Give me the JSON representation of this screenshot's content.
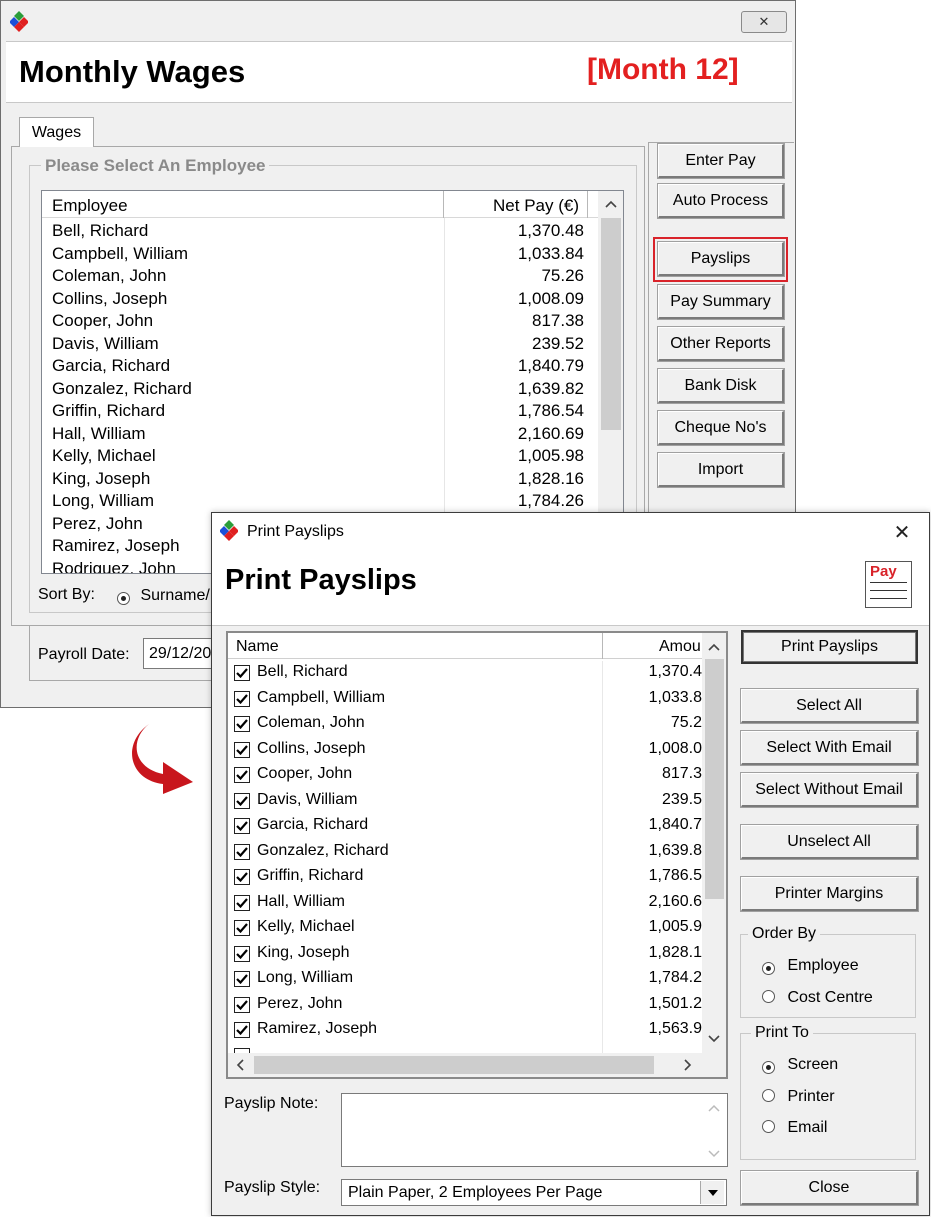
{
  "main": {
    "title": "Monthly Wages",
    "month_badge": "[Month 12]",
    "tab": "Wages",
    "group_label": "Please Select An Employee",
    "columns": {
      "employee": "Employee",
      "net_pay": "Net Pay (€)"
    },
    "employees": [
      {
        "name": "Bell, Richard",
        "pay": "1,370.48"
      },
      {
        "name": "Campbell, William",
        "pay": "1,033.84"
      },
      {
        "name": "Coleman, John",
        "pay": "75.26"
      },
      {
        "name": "Collins, Joseph",
        "pay": "1,008.09"
      },
      {
        "name": "Cooper, John",
        "pay": "817.38"
      },
      {
        "name": "Davis, William",
        "pay": "239.52"
      },
      {
        "name": "Garcia, Richard",
        "pay": "1,840.79"
      },
      {
        "name": "Gonzalez, Richard",
        "pay": "1,639.82"
      },
      {
        "name": "Griffin, Richard",
        "pay": "1,786.54"
      },
      {
        "name": "Hall, William",
        "pay": "2,160.69"
      },
      {
        "name": "Kelly, Michael",
        "pay": "1,005.98"
      },
      {
        "name": "King, Joseph",
        "pay": "1,828.16"
      },
      {
        "name": "Long, William",
        "pay": "1,784.26"
      },
      {
        "name": "Perez, John",
        "pay": ""
      },
      {
        "name": "Ramirez, Joseph",
        "pay": ""
      },
      {
        "name": "Rodriguez, John",
        "pay": ""
      }
    ],
    "sort_by_label": "Sort By:",
    "sort_option": "Surname/",
    "payroll_date_label": "Payroll Date:",
    "payroll_date_value": "29/12/20",
    "buttons": {
      "enter_pay": "Enter Pay",
      "auto_process": "Auto Process",
      "payslips": "Payslips",
      "pay_summary": "Pay Summary",
      "other_reports": "Other Reports",
      "bank_disk": "Bank Disk",
      "cheque_nos": "Cheque No's",
      "import": "Import"
    },
    "close_glyph": "✕",
    "highlight_color": "#d9232a",
    "month_color": "#e32020"
  },
  "dialog": {
    "window_title": "Print Payslips",
    "header_title": "Print Payslips",
    "pay_icon_text": "Pay",
    "close_glyph": "✕",
    "columns": {
      "name": "Name",
      "amount": "Amou"
    },
    "rows": [
      {
        "name": "Bell, Richard",
        "amount": "1,370.4"
      },
      {
        "name": "Campbell, William",
        "amount": "1,033.8"
      },
      {
        "name": "Coleman, John",
        "amount": "75.2"
      },
      {
        "name": "Collins, Joseph",
        "amount": "1,008.0"
      },
      {
        "name": "Cooper, John",
        "amount": "817.3"
      },
      {
        "name": "Davis, William",
        "amount": "239.5"
      },
      {
        "name": "Garcia, Richard",
        "amount": "1,840.7"
      },
      {
        "name": "Gonzalez, Richard",
        "amount": "1,639.8"
      },
      {
        "name": "Griffin, Richard",
        "amount": "1,786.5"
      },
      {
        "name": "Hall, William",
        "amount": "2,160.6"
      },
      {
        "name": "Kelly, Michael",
        "amount": "1,005.9"
      },
      {
        "name": "King, Joseph",
        "amount": "1,828.1"
      },
      {
        "name": "Long, William",
        "amount": "1,784.2"
      },
      {
        "name": "Perez, John",
        "amount": "1,501.2"
      },
      {
        "name": "Ramirez, Joseph",
        "amount": "1,563.9"
      }
    ],
    "buttons": {
      "print_payslips": "Print Payslips",
      "select_all": "Select All",
      "select_with_email": "Select With Email",
      "select_without_email": "Select Without Email",
      "unselect_all": "Unselect All",
      "printer_margins": "Printer Margins",
      "close": "Close"
    },
    "order_by": {
      "label": "Order By",
      "options": [
        "Employee",
        "Cost Centre"
      ],
      "selected": "Employee"
    },
    "print_to": {
      "label": "Print To",
      "options": [
        "Screen",
        "Printer",
        "Email"
      ],
      "selected": "Screen"
    },
    "payslip_note_label": "Payslip Note:",
    "payslip_note_value": "",
    "payslip_style_label": "Payslip Style:",
    "payslip_style_value": "Plain Paper, 2 Employees Per Page",
    "arrow_color": "#c8161d"
  }
}
